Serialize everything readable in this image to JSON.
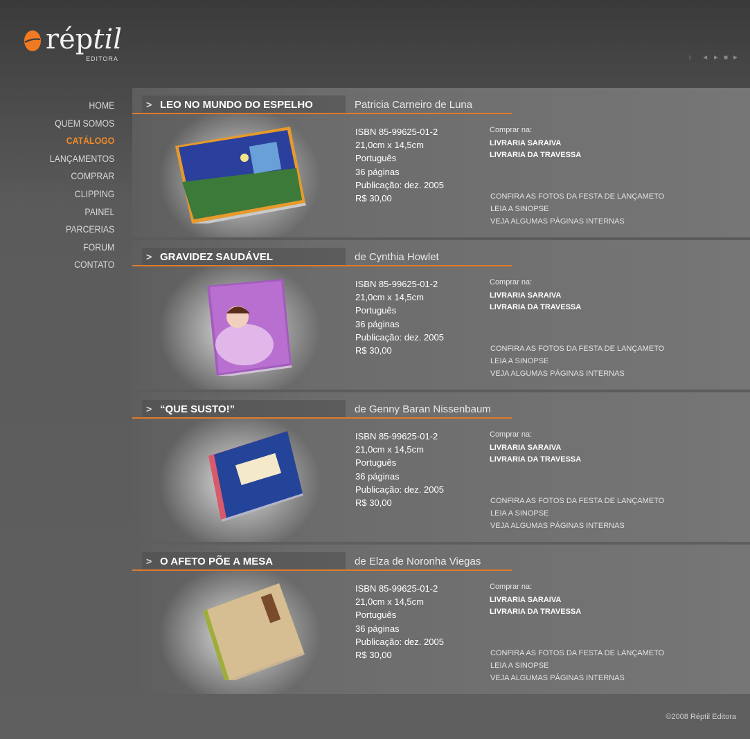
{
  "brand": {
    "name_plain": "rép",
    "name_italic": "til",
    "subtitle": "EDITORA",
    "accent_color": "#f07a22"
  },
  "player": {
    "info": "i",
    "controls": [
      "◄",
      "►",
      "■",
      "►"
    ]
  },
  "menu": [
    {
      "label": "HOME",
      "active": false
    },
    {
      "label": "QUEM SOMOS",
      "active": false
    },
    {
      "label": "CATÁLOGO",
      "active": true
    },
    {
      "label": "LANÇAMENTOS",
      "active": false
    },
    {
      "label": "COMPRAR",
      "active": false
    },
    {
      "label": "CLIPPING",
      "active": false
    },
    {
      "label": "PAINEL",
      "active": false
    },
    {
      "label": "PARCERIAS",
      "active": false
    },
    {
      "label": "FORUM",
      "active": false
    },
    {
      "label": "CONTATO",
      "active": false
    }
  ],
  "books": [
    {
      "arrow": ">",
      "title": "LEO NO MUNDO DO ESPELHO",
      "author": "Patricia Carneiro de Luna",
      "details": [
        "ISBN 85-99625-01-2",
        "21,0cm x 14,5cm",
        "Português",
        "36 páginas",
        "Publicação: dez. 2005",
        "R$ 30,00"
      ],
      "buy_label": "Comprar na:",
      "stores": [
        "LIVRARIA SARAIVA",
        "LIVRARIA DA TRAVESSA"
      ],
      "links": [
        "CONFIRA AS FOTOS DA FESTA DE LANÇAMETO",
        "LEIA A SINOPSE",
        "VEJA ALGUMAS PÁGINAS INTERNAS"
      ],
      "cover_color": "#2b3f9c"
    },
    {
      "arrow": ">",
      "title": "GRAVIDEZ SAUDÁVEL",
      "author": "de Cynthia Howlet",
      "details": [
        "ISBN 85-99625-01-2",
        "21,0cm x 14,5cm",
        "Português",
        "36 páginas",
        "Publicação: dez. 2005",
        "R$ 30,00"
      ],
      "buy_label": "Comprar na:",
      "stores": [
        "LIVRARIA SARAIVA",
        "LIVRARIA DA TRAVESSA"
      ],
      "links": [
        "CONFIRA AS FOTOS DA FESTA DE LANÇAMETO",
        "LEIA A SINOPSE",
        "VEJA ALGUMAS PÁGINAS INTERNAS"
      ],
      "cover_color": "#a35bbd"
    },
    {
      "arrow": ">",
      "title": "“QUE SUSTO!”",
      "author": "de Genny Baran Nissenbaum",
      "details": [
        "ISBN 85-99625-01-2",
        "21,0cm x 14,5cm",
        "Português",
        "36 páginas",
        "Publicação: dez. 2005",
        "R$ 30,00"
      ],
      "buy_label": "Comprar na:",
      "stores": [
        "LIVRARIA SARAIVA",
        "LIVRARIA DA TRAVESSA"
      ],
      "links": [
        "CONFIRA AS FOTOS DA FESTA DE LANÇAMETO",
        "LEIA A SINOPSE",
        "VEJA ALGUMAS PÁGINAS INTERNAS"
      ],
      "cover_color": "#24449a"
    },
    {
      "arrow": ">",
      "title": "O AFETO PÕE A MESA",
      "author": "de Elza de Noronha Viegas",
      "details": [
        "ISBN 85-99625-01-2",
        "21,0cm x 14,5cm",
        "Português",
        "36 páginas",
        "Publicação: dez. 2005",
        "R$ 30,00"
      ],
      "buy_label": "Comprar na:",
      "stores": [
        "LIVRARIA SARAIVA",
        "LIVRARIA DA TRAVESSA"
      ],
      "links": [
        "CONFIRA AS FOTOS DA FESTA DE LANÇAMETO",
        "LEIA A SINOPSE",
        "VEJA ALGUMAS PÁGINAS INTERNAS"
      ],
      "cover_color": "#c9a77a"
    }
  ],
  "footer": {
    "copyright": "©2008 Réptil Editora"
  }
}
